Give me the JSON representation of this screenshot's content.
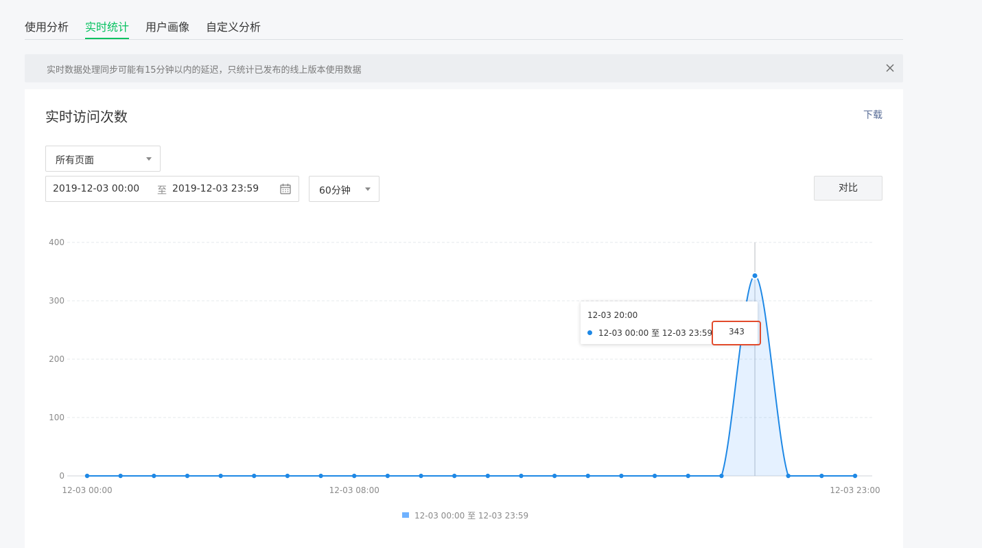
{
  "tabs": [
    {
      "label": "使用分析"
    },
    {
      "label": "实时统计"
    },
    {
      "label": "用户画像"
    },
    {
      "label": "自定义分析"
    }
  ],
  "active_tab": "实时统计",
  "notice": {
    "text": "实时数据处理同步可能有15分钟以内的延迟，只统计已发布的线上版本使用数据"
  },
  "card": {
    "title": "实时访问次数",
    "download_label": "下载"
  },
  "filters": {
    "page_select": "所有页面",
    "date_start": "2019-12-03 00:00",
    "date_sep": "至",
    "date_end": "2019-12-03 23:59",
    "interval": "60分钟",
    "compare_label": "对比"
  },
  "tooltip": {
    "time": "12-03 20:00",
    "series": "12-03 00:00 至 12-03 23:59",
    "value": "343"
  },
  "colors": {
    "accent": "#07c160",
    "line": "#1e88e5",
    "highlight": "#e24a2b",
    "link": "#576b95"
  },
  "chart_data": {
    "type": "area",
    "x": [
      "12-03 00:00",
      "12-03 01:00",
      "12-03 02:00",
      "12-03 03:00",
      "12-03 04:00",
      "12-03 05:00",
      "12-03 06:00",
      "12-03 07:00",
      "12-03 08:00",
      "12-03 09:00",
      "12-03 10:00",
      "12-03 11:00",
      "12-03 12:00",
      "12-03 13:00",
      "12-03 14:00",
      "12-03 15:00",
      "12-03 16:00",
      "12-03 17:00",
      "12-03 18:00",
      "12-03 19:00",
      "12-03 20:00",
      "12-03 21:00",
      "12-03 22:00",
      "12-03 23:00"
    ],
    "x_tick_labels": [
      "12-03 00:00",
      "12-03 08:00",
      "12-03 23:00"
    ],
    "x_tick_index": [
      0,
      8,
      23
    ],
    "series": [
      {
        "name": "12-03 00:00 至 12-03 23:59",
        "values": [
          0,
          0,
          0,
          0,
          0,
          0,
          0,
          0,
          0,
          0,
          0,
          0,
          0,
          0,
          0,
          0,
          0,
          0,
          0,
          0,
          343,
          0,
          0,
          0
        ]
      }
    ],
    "ylim": [
      0,
      400
    ],
    "yticks": [
      0,
      100,
      200,
      300,
      400
    ],
    "grid": true,
    "legend": "bottom-center",
    "hover_index": 20
  }
}
